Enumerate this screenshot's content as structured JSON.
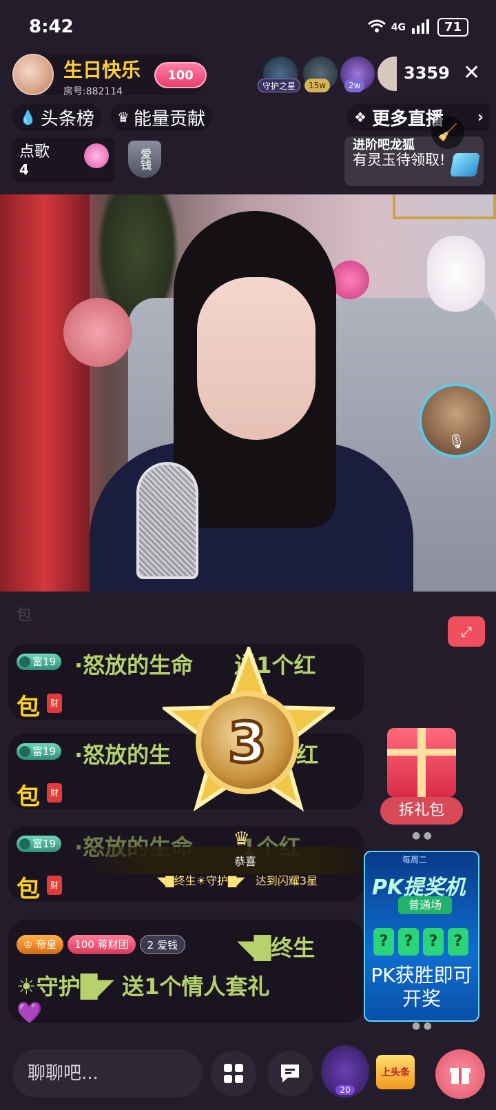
{
  "status_bar": {
    "time": "8:42",
    "network": "4G",
    "battery": "71"
  },
  "host": {
    "name": "生日快乐",
    "room_label": "房号:882114",
    "level": "100"
  },
  "viewers": {
    "tags": [
      "守护之星",
      "15w",
      "2w"
    ],
    "count": "3359"
  },
  "nav": {
    "headline_rank": "头条榜",
    "energy": "能量贡献",
    "more_live": "更多直播"
  },
  "song": {
    "label": "点歌",
    "count": "4"
  },
  "shield_label": "爱钱",
  "promo": {
    "title": "进阶吧龙狐",
    "text": "有灵玉待领取!"
  },
  "chat": {
    "ghost": "包",
    "messages": [
      {
        "rank": "富19",
        "text": "怒放的生命",
        "text_tail": "送1个红",
        "bao": "包",
        "cai": "财"
      },
      {
        "rank": "富19",
        "text": "怒放的生",
        "text_tail": "个红",
        "bao": "包",
        "cai": "财"
      },
      {
        "rank": "富19",
        "text": "怒放的生命",
        "text_tail": "1个红",
        "bao": "包",
        "cai": "财"
      }
    ],
    "last": {
      "badge_emperor": "帝皇",
      "badge_group_level": "100",
      "badge_group": "蒋财团",
      "badge_love_level": "2",
      "badge_love": "爱钱",
      "line1": "终生",
      "line2_a": "守护",
      "line2_b": "送1个情人套礼"
    }
  },
  "level_up": {
    "star_number": "3",
    "congrats": "恭喜",
    "name": "终生☀守护",
    "text": "达到闪耀3星"
  },
  "gift_pack": {
    "label": "拆礼包"
  },
  "pk": {
    "weekday": "每周二",
    "title": "PK提奖机",
    "field": "普通场",
    "q": "?",
    "win_text": "PK获胜即可开奖"
  },
  "bottom": {
    "input_placeholder": "聊聊吧...",
    "level_badge": "20",
    "headline_btn": "上头条"
  },
  "colors": {
    "bg": "#231c2b",
    "host_name": "#ffcf3a",
    "chat_text": "#b6d26c",
    "bao": "#ffd21f",
    "accent_red": "#f0505e"
  }
}
